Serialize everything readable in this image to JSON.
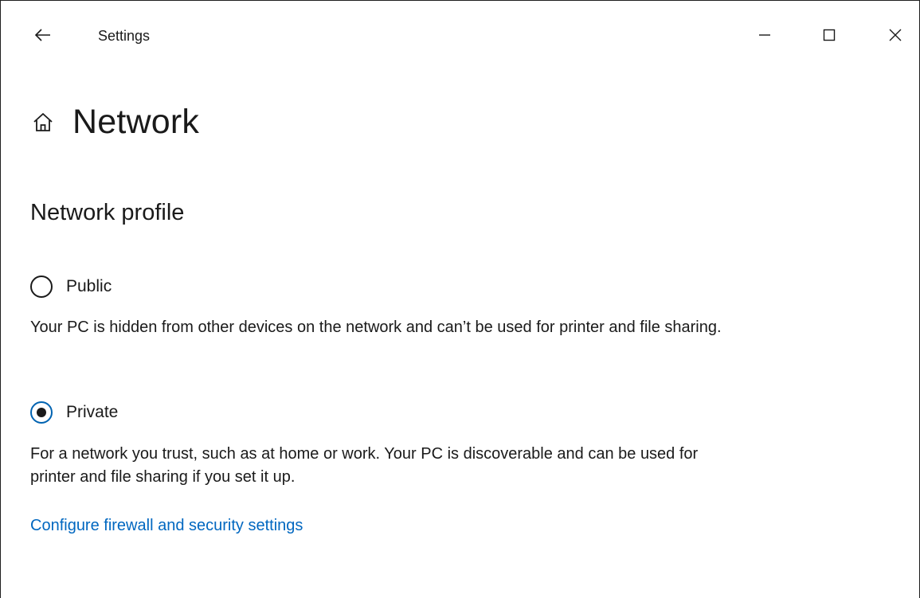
{
  "window": {
    "title": "Settings",
    "icons": {
      "back": "back-arrow-icon",
      "minimize": "minimize-icon",
      "maximize": "maximize-icon",
      "close": "close-icon"
    }
  },
  "page": {
    "title": "Network",
    "home_icon": "home-icon"
  },
  "network_profile": {
    "heading": "Network profile",
    "options": [
      {
        "label": "Public",
        "selected": false,
        "description": "Your PC is hidden from other devices on the network and can’t be used for printer and file sharing."
      },
      {
        "label": "Private",
        "selected": true,
        "description": "For a network you trust, such as at home or work. Your PC is discoverable and can be used for printer and file sharing if you set it up."
      }
    ],
    "link": "Configure firewall and security settings"
  },
  "colors": {
    "accent": "#0063b1",
    "link": "#0067c0",
    "text": "#1a1a1a",
    "background": "#ffffff"
  }
}
